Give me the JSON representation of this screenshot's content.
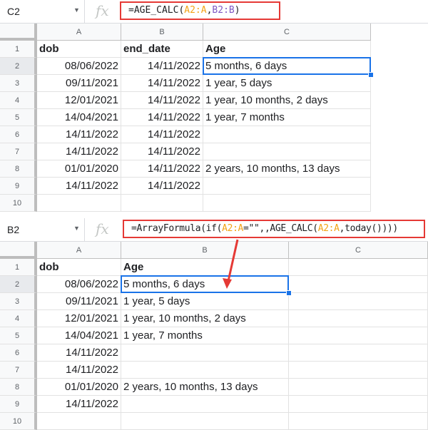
{
  "top_sheet": {
    "name_box": "C2",
    "fx_icon": "fx",
    "formula": {
      "prefix": "=AGE_CALC(",
      "ref1": "A2:A",
      "sep": ",",
      "ref2": "B2:B",
      "suffix": ")"
    },
    "columns": [
      "A",
      "B",
      "C"
    ],
    "row_numbers": [
      "1",
      "2",
      "3",
      "4",
      "5",
      "6",
      "7",
      "8",
      "9",
      "10"
    ],
    "header_row": [
      "dob",
      "end_date",
      "Age"
    ],
    "rows": [
      [
        "08/06/2022",
        "14/11/2022",
        "5 months, 6 days"
      ],
      [
        "09/11/2021",
        "14/11/2022",
        "1 year, 5 days"
      ],
      [
        "12/01/2021",
        "14/11/2022",
        "1 year, 10 months, 2 days"
      ],
      [
        "14/04/2021",
        "14/11/2022",
        "1 year, 7 months"
      ],
      [
        "14/11/2022",
        "14/11/2022",
        ""
      ],
      [
        "14/11/2022",
        "14/11/2022",
        ""
      ],
      [
        "01/01/2020",
        "14/11/2022",
        "2 years, 10 months, 13 days"
      ],
      [
        "14/11/2022",
        "14/11/2022",
        ""
      ]
    ]
  },
  "bottom_sheet": {
    "name_box": "B2",
    "fx_icon": "fx",
    "formula": {
      "p1": "=ArrayFormula(if(",
      "ref1": "A2:A",
      "p2": "=\"\",,AGE_CALC(",
      "ref2": "A2:A",
      "p3": ",today())))"
    },
    "columns": [
      "A",
      "B",
      "C"
    ],
    "row_numbers": [
      "1",
      "2",
      "3",
      "4",
      "5",
      "6",
      "7",
      "8",
      "9",
      "10"
    ],
    "header_row": [
      "dob",
      "Age"
    ],
    "rows": [
      [
        "08/06/2022",
        "5 months, 6 days"
      ],
      [
        "09/11/2021",
        "1 year, 5 days"
      ],
      [
        "12/01/2021",
        "1 year, 10 months, 2 days"
      ],
      [
        "14/04/2021",
        "1 year, 7 months"
      ],
      [
        "14/11/2022",
        ""
      ],
      [
        "14/11/2022",
        ""
      ],
      [
        "01/01/2020",
        "2 years, 10 months, 13 days"
      ],
      [
        "14/11/2022",
        ""
      ]
    ]
  },
  "colors": {
    "highlight_box": "#e53935",
    "selection": "#1a73e8",
    "ref_a": "#f3a316",
    "ref_b": "#7e57c2"
  }
}
